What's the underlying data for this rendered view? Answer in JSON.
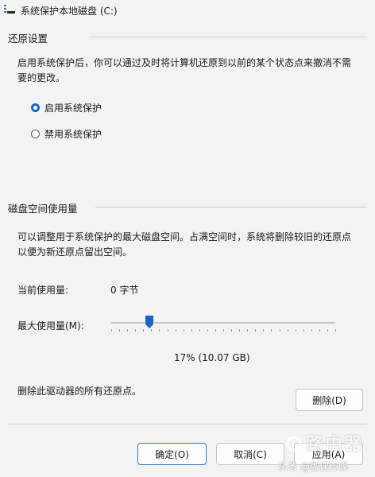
{
  "window": {
    "title": "系统保护本地磁盘 (C:)",
    "icon": "bars-icon"
  },
  "restore": {
    "heading": "还原设置",
    "description_line1": "启用系统保护后，你可以通过及时将计算机还原到以前的某个状态点来撤消不需",
    "description_line2": "要的更改。",
    "options": [
      {
        "label": "启用系统保护",
        "selected": true
      },
      {
        "label": "禁用系统保护",
        "selected": false
      }
    ]
  },
  "disk": {
    "heading": "磁盘空间使用量",
    "description_line1": "可以调整用于系统保护的最大磁盘空间。占满空间时，系统将删除较旧的还原点",
    "description_line2": "以便为新还原点留出空间。",
    "current_label": "当前使用量:",
    "current_value": "0 字节",
    "max_label": "最大使用量(M):",
    "slider_percent": 17,
    "slider_value_text": "17% (10.07 GB)",
    "delete_text": "删除此驱动器的所有还原点。",
    "delete_button": "删除(D)"
  },
  "footer": {
    "ok": "确定(O)",
    "cancel": "取消(C)",
    "apply": "应用(A)"
  },
  "watermark": {
    "brand": "路由器",
    "caption": "头条 @微课传媒"
  },
  "colors": {
    "accent": "#1667c9",
    "background": "#f3f3f3"
  }
}
